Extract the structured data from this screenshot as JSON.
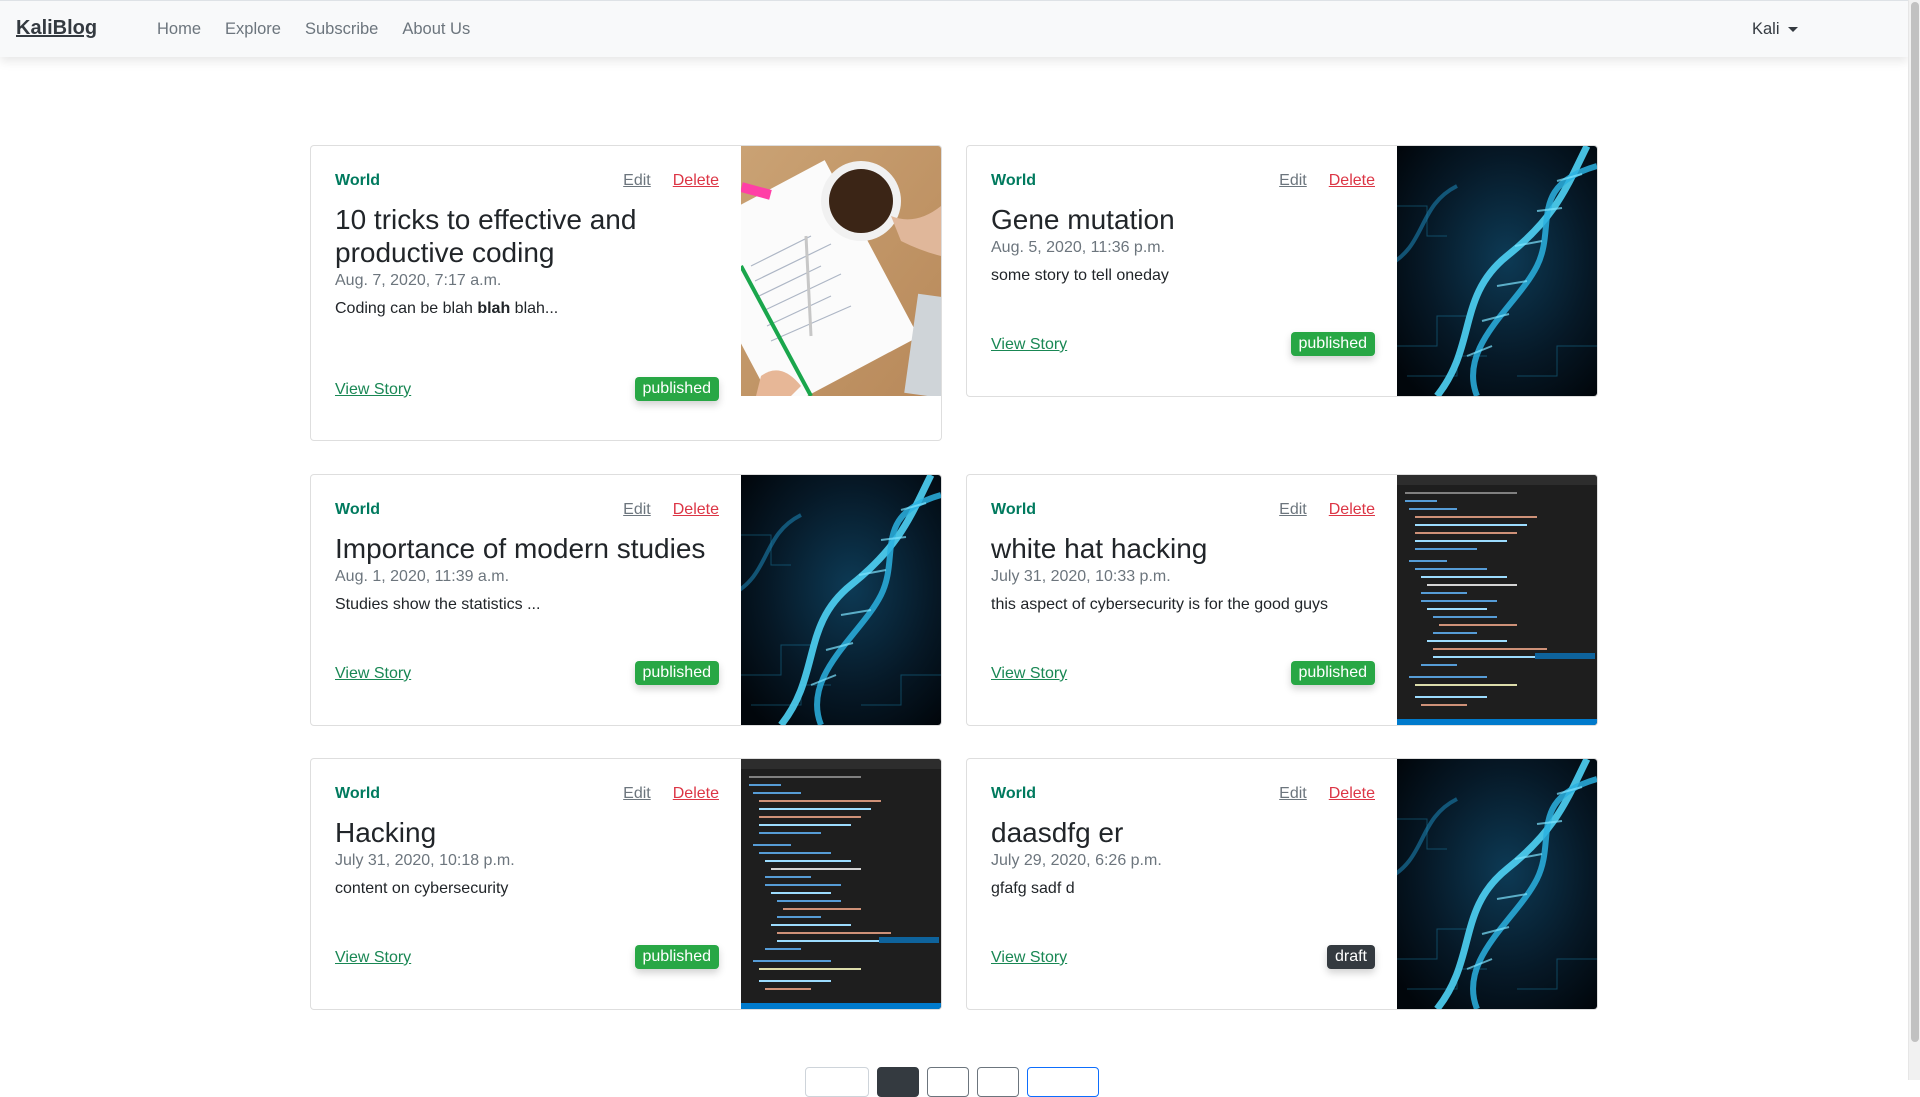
{
  "navbar": {
    "brand": "KaliBlog",
    "links": [
      "Home",
      "Explore",
      "Subscribe",
      "About Us"
    ],
    "user": "Kali"
  },
  "posts": [
    {
      "category": "World",
      "edit": "Edit",
      "delete": "Delete",
      "title": "10 tricks to effective and productive coding",
      "date": "Aug. 7, 2020, 7:17 a.m.",
      "excerpt_before": "Coding can be blah ",
      "excerpt_bold": "blah",
      "excerpt_after": " blah...",
      "view": "View Story",
      "status": "published",
      "image": "notebook-coffee-desk"
    },
    {
      "category": "World",
      "edit": "Edit",
      "delete": "Delete",
      "title": "Gene mutation",
      "date": "Aug. 5, 2020, 11:36 p.m.",
      "excerpt_before": "some story to tell oneday",
      "excerpt_bold": "",
      "excerpt_after": "",
      "view": "View Story",
      "status": "published",
      "image": "dna-helix"
    },
    {
      "category": "World",
      "edit": "Edit",
      "delete": "Delete",
      "title": "Importance of modern studies",
      "date": "Aug. 1, 2020, 11:39 a.m.",
      "excerpt_before": "Studies show the statistics ...",
      "excerpt_bold": "",
      "excerpt_after": "",
      "view": "View Story",
      "status": "published",
      "image": "dna-helix"
    },
    {
      "category": "World",
      "edit": "Edit",
      "delete": "Delete",
      "title": "white hat hacking",
      "date": "July 31, 2020, 10:33 p.m.",
      "excerpt_before": "this aspect of cybersecurity is for the good guys",
      "excerpt_bold": "",
      "excerpt_after": "",
      "view": "View Story",
      "status": "published",
      "image": "code-editor"
    },
    {
      "category": "World",
      "edit": "Edit",
      "delete": "Delete",
      "title": "Hacking",
      "date": "July 31, 2020, 10:18 p.m.",
      "excerpt_before": "content on cybersecurity",
      "excerpt_bold": "",
      "excerpt_after": "",
      "view": "View Story",
      "status": "published",
      "image": "code-editor"
    },
    {
      "category": "World",
      "edit": "Edit",
      "delete": "Delete",
      "title": "daasdfg er",
      "date": "July 29, 2020, 6:26 p.m.",
      "excerpt_before": "gfafg sadf d",
      "excerpt_bold": "",
      "excerpt_after": "",
      "view": "View Story",
      "status": "draft",
      "image": "dna-helix"
    }
  ],
  "colors": {
    "category": "#007a5e",
    "published": "#28a745",
    "draft": "#343a40",
    "delete": "#dc3545",
    "link": "#198754"
  }
}
